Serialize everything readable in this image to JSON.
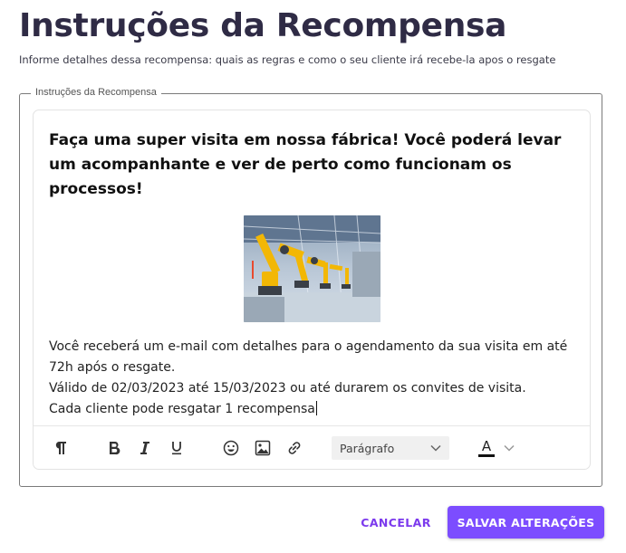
{
  "page": {
    "title": "Instruções da Recompensa",
    "subtitle": "Informe detalhes dessa recompensa: quais as regras e como o seu cliente irá recebe-la apos o resgate"
  },
  "field": {
    "legend": "Instruções da Recompensa"
  },
  "editor": {
    "heading": "Faça uma super visita em nossa fábrica! Você poderá levar um acompanhante e ver de perto como funcionam os processos!",
    "paragraphs": [
      "Você receberá um e-mail com detalhes para o agendamento da sua visita em até 72h após o resgate.",
      "Válido de 02/03/2023 até 15/03/2023 ou até durarem os convites de visita.",
      "Cada cliente pode resgatar 1 recompensa"
    ],
    "toolbar": {
      "icons": [
        "paragraph-icon",
        "bold-icon",
        "italic-icon",
        "underline-icon",
        "emoji-icon",
        "image-icon",
        "link-icon",
        "chevron-down-icon",
        "text-color-icon"
      ],
      "paragraph_select": "Parágrafo",
      "text_color_label": "A",
      "text_color": "#111111"
    }
  },
  "actions": {
    "cancel": "CANCELAR",
    "save": "SALVAR ALTERAÇÕES"
  },
  "colors": {
    "accent": "#7c4dff",
    "accent_text": "#7c3aed",
    "title": "#2f2b45"
  }
}
